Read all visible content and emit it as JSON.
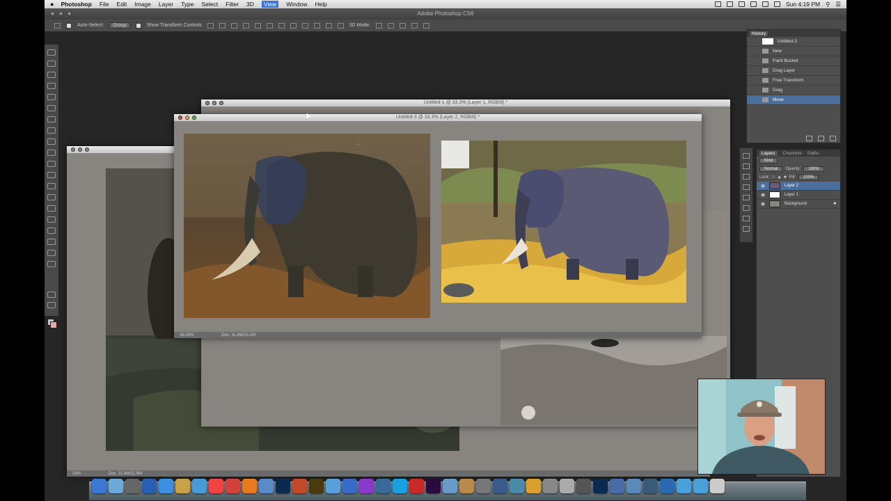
{
  "menubar": {
    "apple": "",
    "items": [
      "Photoshop",
      "File",
      "Edit",
      "Image",
      "Layer",
      "Type",
      "Select",
      "Filter",
      "3D",
      "View",
      "Window",
      "Help"
    ],
    "clock": "Sun 4:19 PM"
  },
  "app": {
    "title": "Adobe Photoshop CS6"
  },
  "options": {
    "auto_select_label": "Auto-Select:",
    "auto_select_value": "Group",
    "show_transform_label": "Show Transform Controls",
    "mode_3d_label": "3D Mode:"
  },
  "windows": {
    "back_title": "Untitled-1 @ 33.3% (Layer 1, RGB/8) *",
    "front_title": "Untitled-3 @ 33.3% (Layer 2, RGB/8) *",
    "front_zoom": "33.33%",
    "front_doc": "Doc: 11.4M/23.1M",
    "left_zoom": "33%",
    "left_doc": "Doc: 11.4M/11.8M"
  },
  "history": {
    "tab": "History",
    "snapshot": "Untitled-3",
    "items": [
      "New",
      "Paint Bucket",
      "Drag Layer",
      "Free Transform",
      "Drag",
      "Move"
    ]
  },
  "layers": {
    "tabs": [
      "Layers",
      "Channels",
      "Paths"
    ],
    "kind": "Kind",
    "blend": "Normal",
    "opacity_label": "Opacity:",
    "opacity": "100%",
    "lock_label": "Lock:",
    "fill_label": "Fill:",
    "fill": "100%",
    "items": [
      "Layer 2",
      "Layer 1",
      "Background"
    ]
  },
  "colors": {
    "menubar_active": "#3b74d6",
    "selection": "#4b6e9b",
    "canvas_bg": "#888480"
  }
}
